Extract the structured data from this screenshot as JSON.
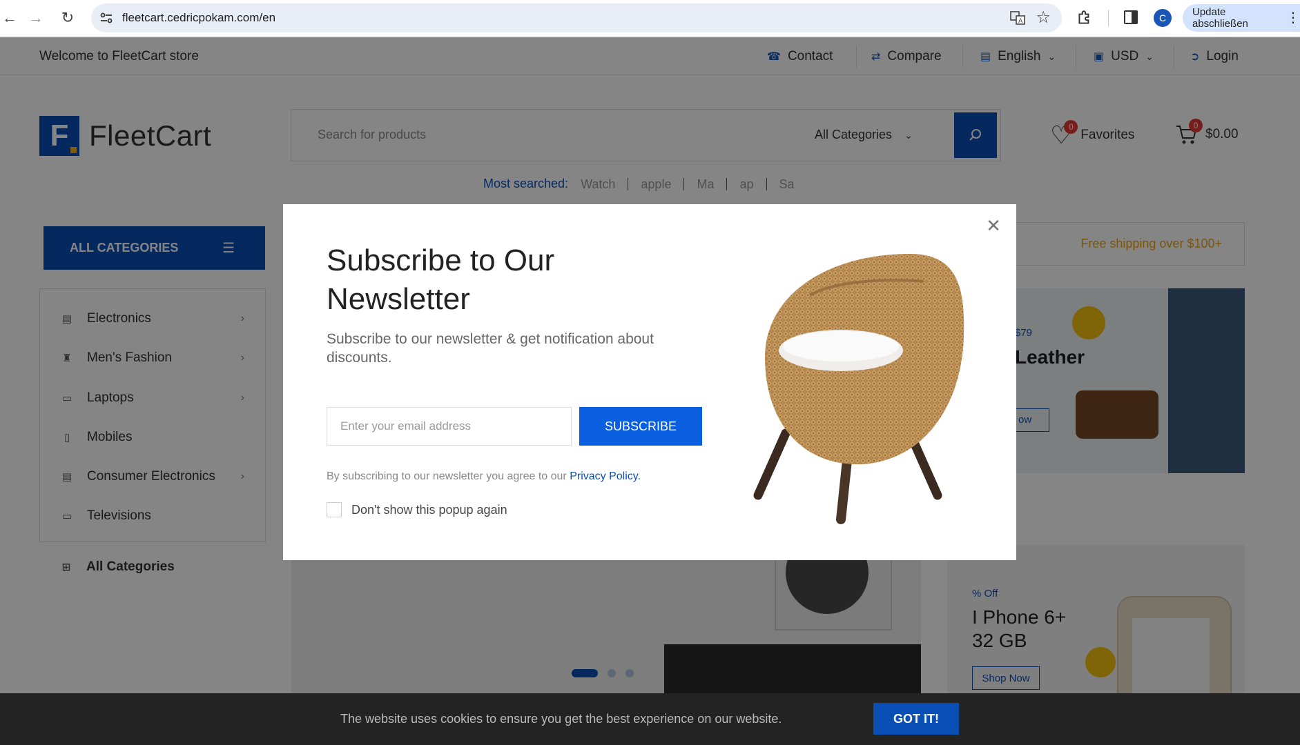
{
  "browser": {
    "url": "fleetcart.cedricpokam.com/en",
    "profile_initial": "C",
    "update_label": "Update abschließen"
  },
  "topbar": {
    "welcome": "Welcome to FleetCart store",
    "contact": "Contact",
    "compare": "Compare",
    "language": "English",
    "currency": "USD",
    "login": "Login"
  },
  "header": {
    "logo_text": "FleetCart",
    "logo_letter": "F",
    "search_placeholder": "Search for products",
    "search_category": "All Categories",
    "favorites_label": "Favorites",
    "favorites_count": "0",
    "cart_total": "$0.00",
    "cart_count": "0"
  },
  "most_searched": {
    "label": "Most searched:",
    "terms": [
      "Watch",
      "apple",
      "Ma",
      "ap",
      "Sa"
    ]
  },
  "nav": {
    "all_categories_button": "ALL CATEGORIES",
    "free_shipping": "Free shipping over $100+"
  },
  "sidebar": {
    "items": [
      {
        "label": "Electronics",
        "icon": "calendar-icon",
        "has_children": true
      },
      {
        "label": "Men's Fashion",
        "icon": "shirt-icon",
        "has_children": true
      },
      {
        "label": "Laptops",
        "icon": "laptop-icon",
        "has_children": true
      },
      {
        "label": "Mobiles",
        "icon": "mobile-icon",
        "has_children": false
      },
      {
        "label": "Consumer Electronics",
        "icon": "device-icon",
        "has_children": true
      },
      {
        "label": "Televisions",
        "icon": "tv-icon",
        "has_children": false
      },
      {
        "label": "All Categories",
        "icon": "plus-box-icon",
        "has_children": false
      }
    ]
  },
  "banners": {
    "leather_price": "$79",
    "leather_title": "Leather",
    "leather_button": "ow",
    "iphone_offer": "% Off",
    "iphone_title_1": "I Phone 6+",
    "iphone_title_2": "32 GB",
    "iphone_button": "Shop Now"
  },
  "slider": {
    "count": 3,
    "active": 0
  },
  "modal": {
    "title": "Subscribe to Our Newsletter",
    "subtitle": "Subscribe to our newsletter & get notification about discounts.",
    "email_placeholder": "Enter your email address",
    "subscribe_label": "SUBSCRIBE",
    "agree_text": "By subscribing to our newsletter you agree to our",
    "privacy_link": "Privacy Policy.",
    "dont_show": "Don't show this popup again",
    "dont_show_checked": false
  },
  "cookie": {
    "text": "The website uses cookies to ensure you get the best experience on our website.",
    "button": "GOT IT!"
  },
  "colors": {
    "primary": "#0a4fb5",
    "subscribe": "#0a5fe0",
    "accent": "#e8a41d",
    "badge": "#e53935",
    "cookie_bg": "#232323"
  }
}
